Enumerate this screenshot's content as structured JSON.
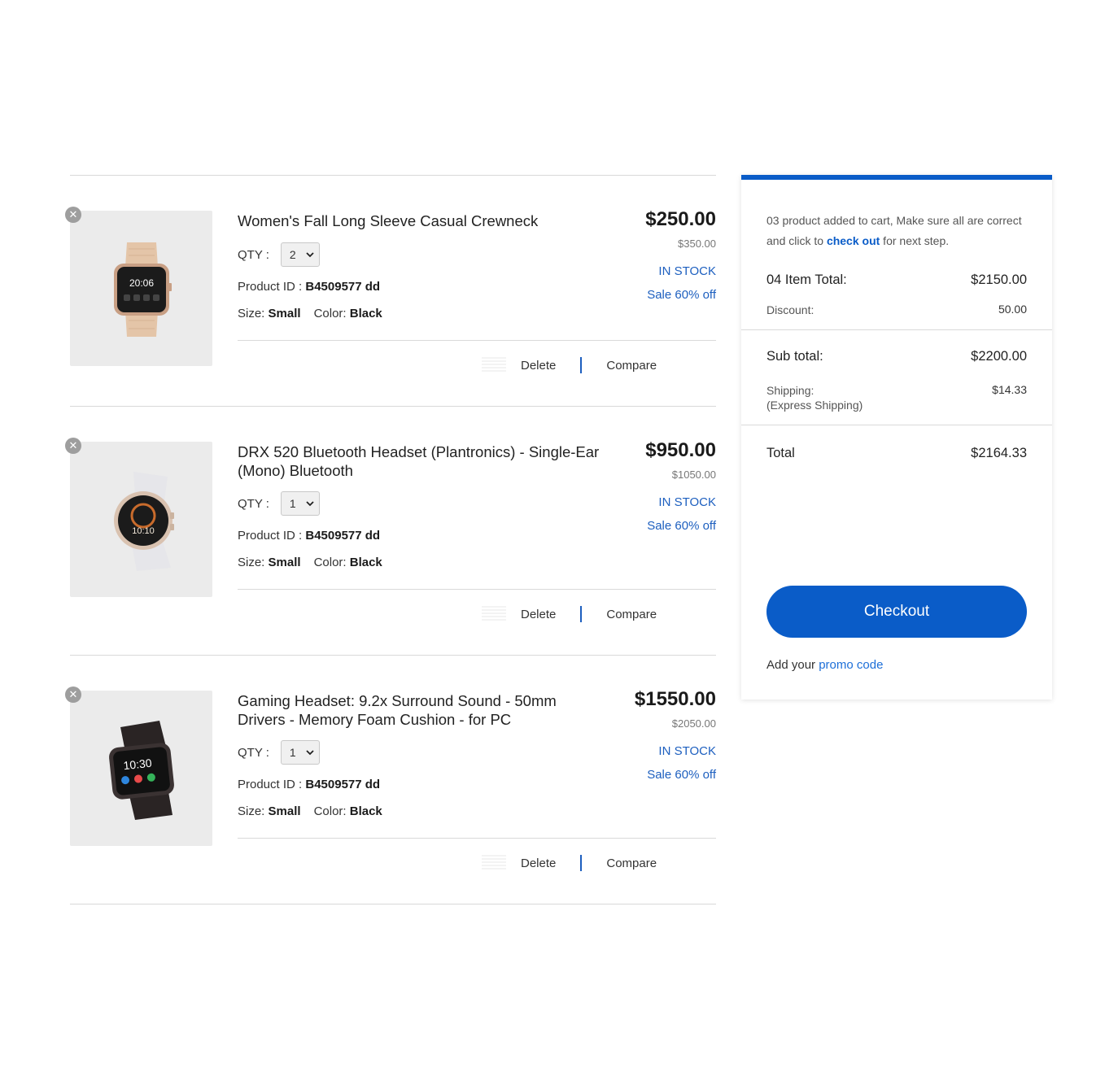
{
  "cart": {
    "items": [
      {
        "title": "Women's Fall Long Sleeve Casual Crewneck",
        "price": "$250.00",
        "old_price": "$350.00",
        "stock": "IN STOCK",
        "sale": "Sale 60% off",
        "qty_label": "QTY :",
        "qty": "2",
        "pid_label": "Product ID :",
        "pid": "B4509577 dd",
        "size_label": "Size:",
        "size": "Small",
        "color_label": "Color:",
        "color": "Black",
        "delete_label": "Delete",
        "compare_label": "Compare",
        "watch_time": "20:06",
        "watch_style": "rose-gold-square-watch"
      },
      {
        "title": "DRX 520 Bluetooth Headset (Plantronics) - Single-Ear (Mono) Bluetooth",
        "price": "$950.00",
        "old_price": "$1050.00",
        "stock": "IN STOCK",
        "sale": "Sale 60% off",
        "qty_label": "QTY :",
        "qty": "1",
        "pid_label": "Product ID :",
        "pid": "B4509577 dd",
        "size_label": "Size:",
        "size": "Small",
        "color_label": "Color:",
        "color": "Black",
        "delete_label": "Delete",
        "compare_label": "Compare",
        "watch_time": "10:10",
        "watch_style": "white-round-watch"
      },
      {
        "title": "Gaming Headset: 9.2x Surround Sound - 50mm Drivers - Memory Foam Cushion - for PC",
        "price": "$1550.00",
        "old_price": "$2050.00",
        "stock": "IN STOCK",
        "sale": "Sale 60% off",
        "qty_label": "QTY :",
        "qty": "1",
        "pid_label": "Product ID :",
        "pid": "B4509577 dd",
        "size_label": "Size:",
        "size": "Small",
        "color_label": "Color:",
        "color": "Black",
        "delete_label": "Delete",
        "compare_label": "Compare",
        "watch_time": "10:30",
        "watch_style": "black-square-watch"
      }
    ]
  },
  "summary": {
    "note_prefix": "03 product added to cart, Make sure all are correct and click to ",
    "note_link": "check out",
    "note_suffix": " for next step.",
    "item_total_label": "04 Item Total:",
    "item_total": "$2150.00",
    "discount_label": "Discount:",
    "discount": "50.00",
    "subtotal_label": "Sub total:",
    "subtotal": "$2200.00",
    "shipping_label": "Shipping:",
    "shipping_method": "(Express Shipping)",
    "shipping": "$14.33",
    "total_label": "Total",
    "total": "$2164.33",
    "checkout_label": "Checkout",
    "promo_prefix": "Add your ",
    "promo_link": "promo code"
  },
  "colors": {
    "accent": "#0a5cc8",
    "link": "#1d5fbf",
    "thumb_bg": "#ebebeb"
  },
  "icons": [
    "close-icon",
    "chevron-down-icon",
    "smartwatch-image"
  ]
}
